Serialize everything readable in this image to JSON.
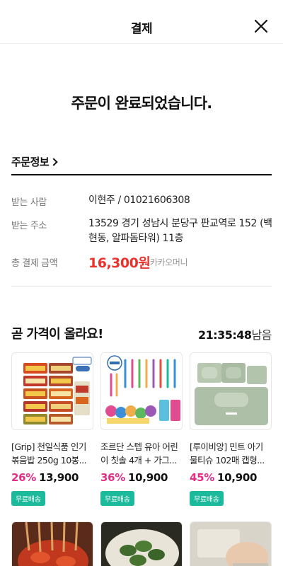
{
  "header": {
    "title": "결제"
  },
  "completion": {
    "message": "주문이 완료되었습니다."
  },
  "order_info": {
    "title": "주문정보",
    "recipient_label": "받는 사람",
    "recipient_value": "이현주 / 01021606308",
    "address_label": "받는 주소",
    "address_value": "13529 경기 성남시 분당구 판교역로 152 (백현동, 알파돔타워) 11층",
    "total_label": "총 결제 금액",
    "total_value": "16,300원",
    "pay_method": "카카오머니"
  },
  "price_up": {
    "title": "곧 가격이 올라요!",
    "countdown_time": "21:35:48",
    "countdown_suffix": "남음",
    "products": [
      {
        "name": "[Grip] 천일식품 인기 볶음밥 250g 10봉...",
        "discount": "26%",
        "price": "13,900",
        "badge": "무료배송"
      },
      {
        "name": "조르단 스텝 유아 어린이 칫솔 4개 + 가그...",
        "discount": "36%",
        "price": "10,900",
        "badge": "무료배송"
      },
      {
        "name": "[루이비앙] 민트 아기 물티슈 102매 캡형...",
        "discount": "45%",
        "price": "10,900",
        "badge": "무료배송"
      }
    ]
  },
  "colors": {
    "amount": "#e8322b",
    "discount": "#e52d86",
    "badge": "#1cba9c"
  }
}
